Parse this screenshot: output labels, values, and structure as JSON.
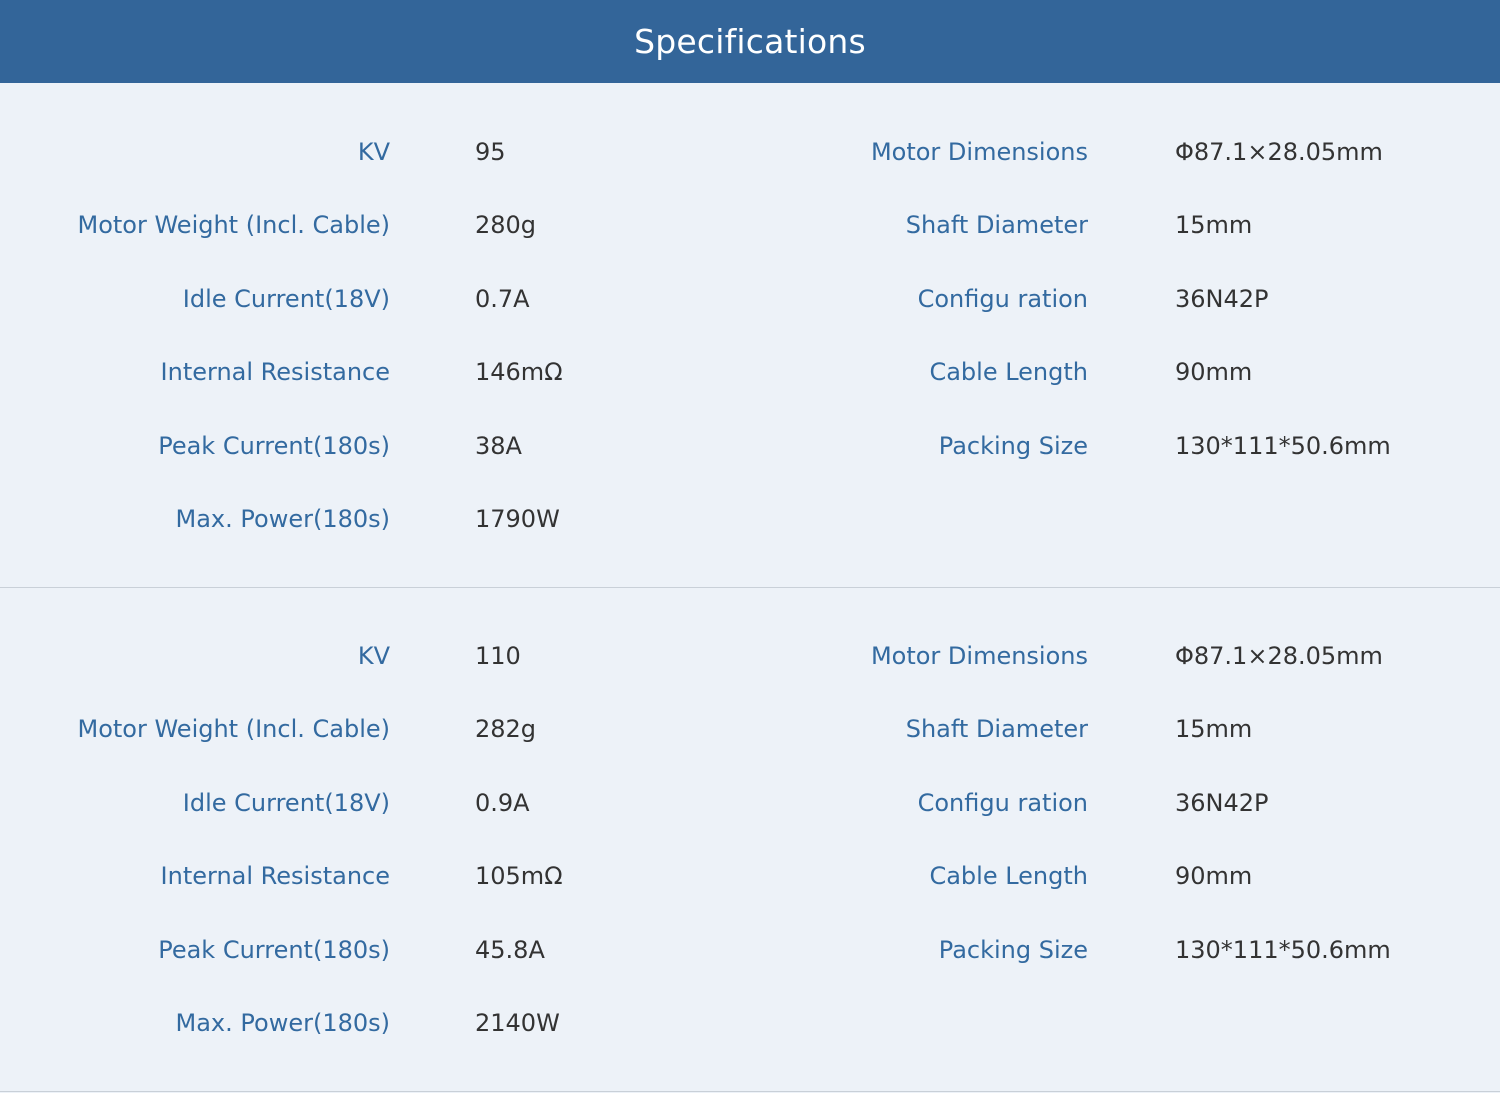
{
  "header": {
    "title": "Specifications"
  },
  "sections": [
    {
      "left": [
        {
          "label": "KV",
          "value": "95"
        },
        {
          "label": "Motor Weight (Incl. Cable)",
          "value": "280g"
        },
        {
          "label": "Idle Current(18V)",
          "value": "0.7A"
        },
        {
          "label": "Internal Resistance",
          "value": "146mΩ"
        },
        {
          "label": "Peak Current(180s)",
          "value": "38A"
        },
        {
          "label": "Max. Power(180s)",
          "value": "1790W"
        }
      ],
      "right": [
        {
          "label": "Motor Dimensions",
          "value": "Φ87.1×28.05mm"
        },
        {
          "label": "Shaft Diameter",
          "value": "15mm"
        },
        {
          "label": "Configu ration",
          "value": "36N42P"
        },
        {
          "label": "Cable Length",
          "value": "90mm"
        },
        {
          "label": "Packing Size",
          "value": "130*111*50.6mm"
        }
      ]
    },
    {
      "left": [
        {
          "label": "KV",
          "value": "110"
        },
        {
          "label": "Motor Weight (Incl. Cable)",
          "value": "282g"
        },
        {
          "label": "Idle Current(18V)",
          "value": "0.9A"
        },
        {
          "label": "Internal Resistance",
          "value": "105mΩ"
        },
        {
          "label": "Peak Current(180s)",
          "value": "45.8A"
        },
        {
          "label": "Max. Power(180s)",
          "value": "2140W"
        }
      ],
      "right": [
        {
          "label": "Motor Dimensions",
          "value": "Φ87.1×28.05mm"
        },
        {
          "label": "Shaft Diameter",
          "value": "15mm"
        },
        {
          "label": "Configu ration",
          "value": "36N42P"
        },
        {
          "label": "Cable Length",
          "value": "90mm"
        },
        {
          "label": "Packing Size",
          "value": "130*111*50.6mm"
        }
      ]
    }
  ]
}
